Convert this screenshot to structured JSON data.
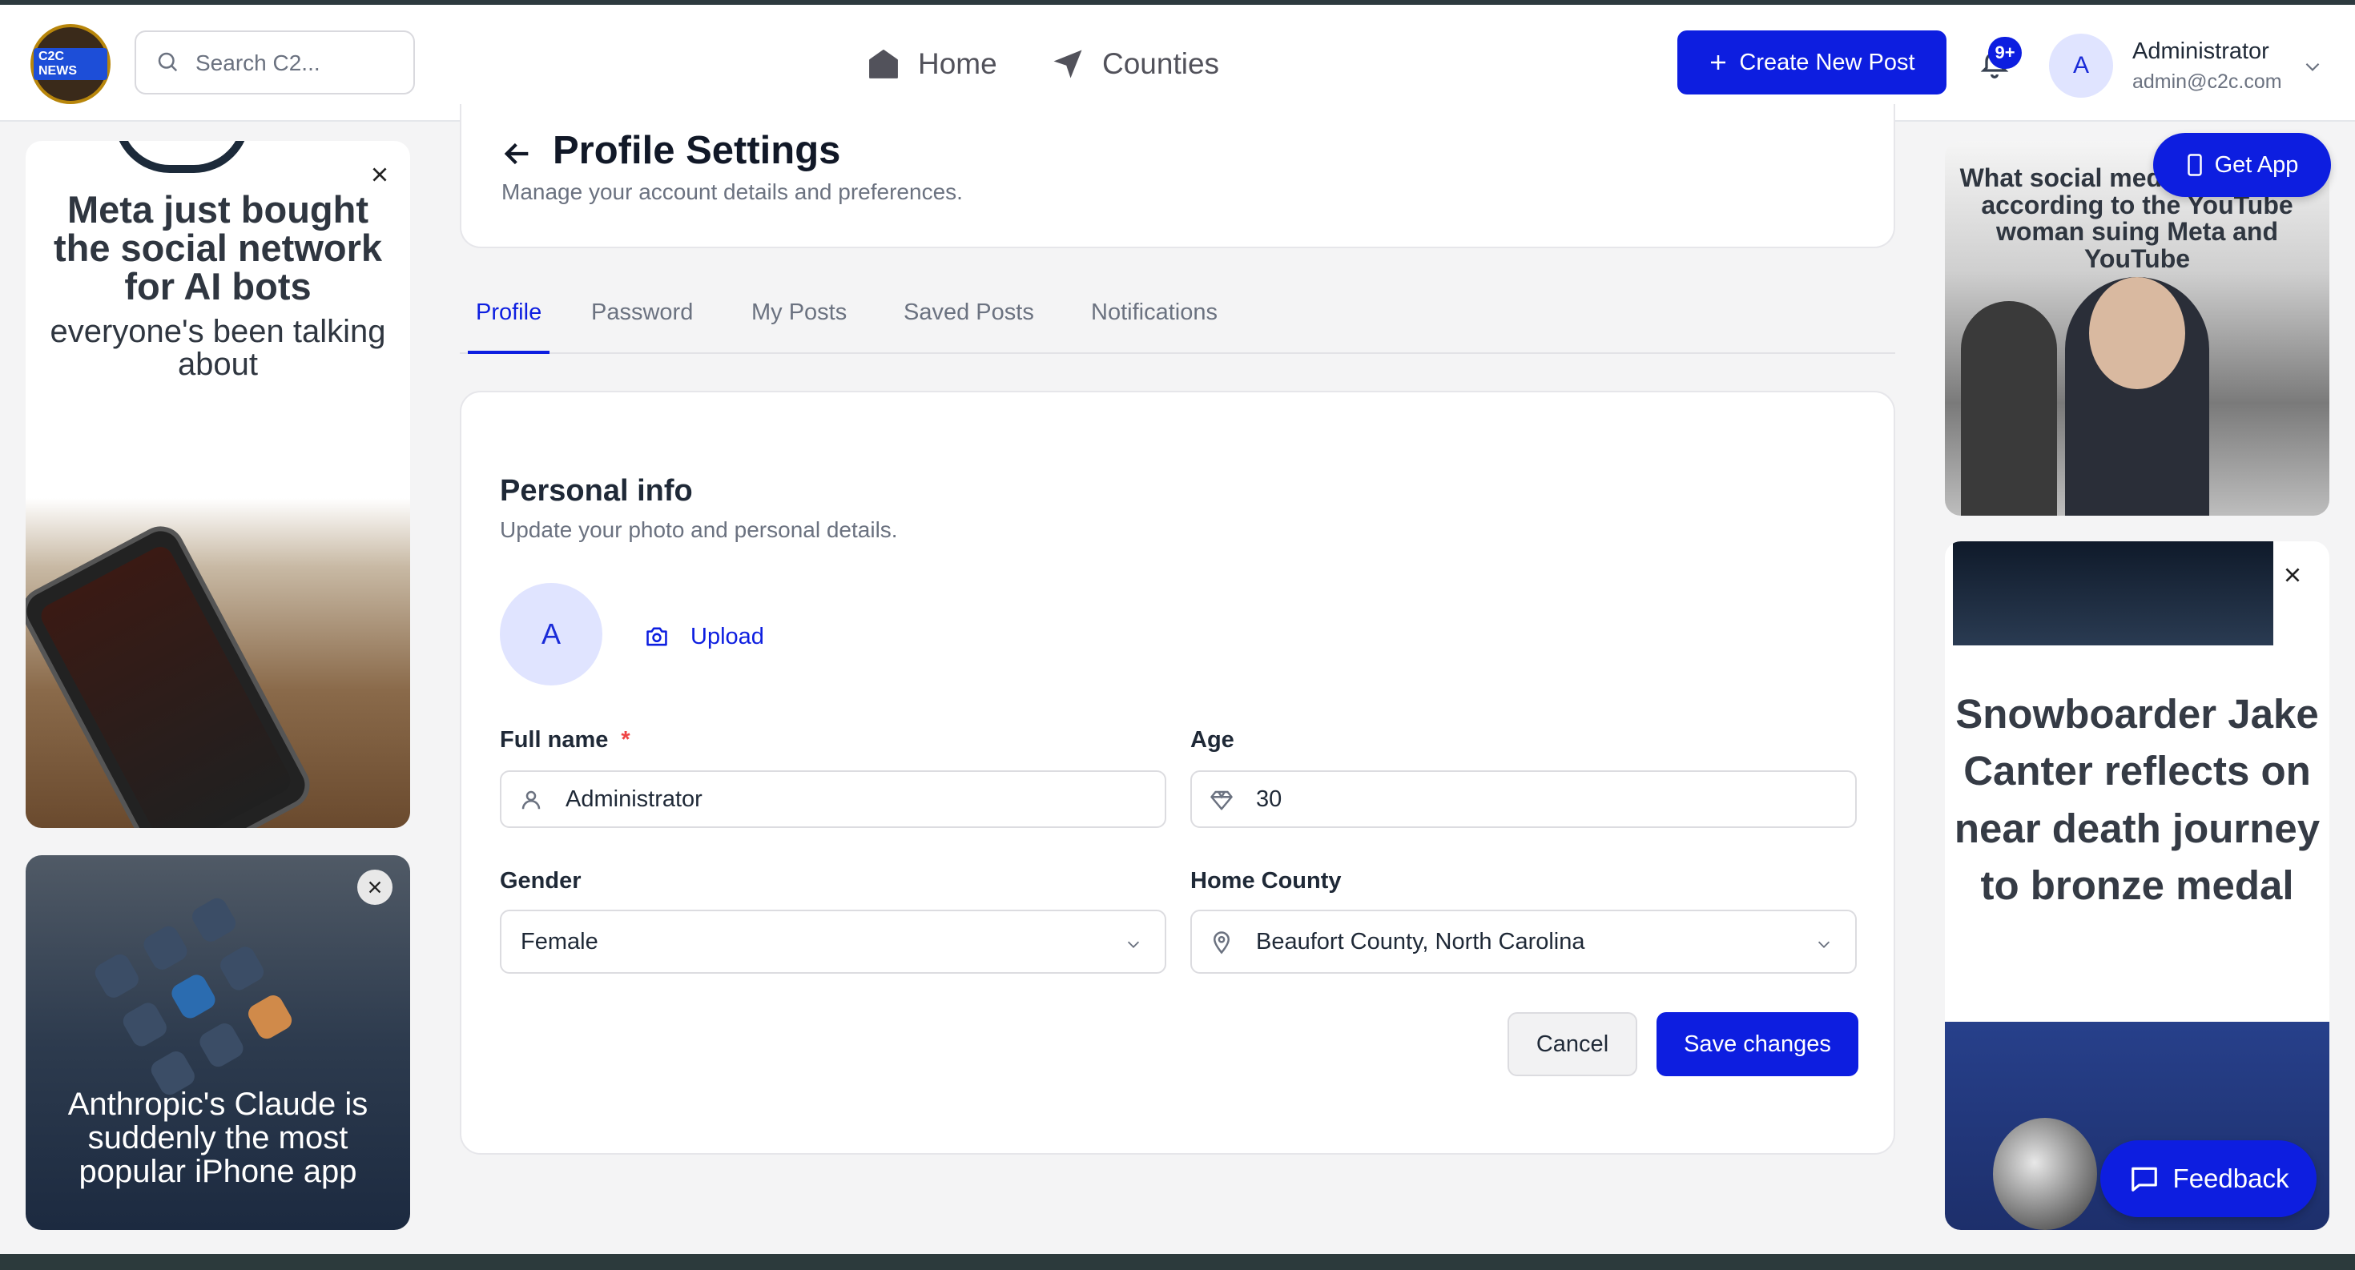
{
  "header": {
    "logo_text": "C2C NEWS",
    "search_placeholder": "Search C2...",
    "nav": [
      {
        "label": "Home",
        "icon": "home-icon"
      },
      {
        "label": "Counties",
        "icon": "navigation-arrow-icon"
      }
    ],
    "create_post_label": "Create New Post",
    "notification_badge": "9+",
    "avatar_initial": "A",
    "user_name": "Administrator",
    "user_email": "admin@c2c.com"
  },
  "floating": {
    "get_app_label": "Get App",
    "feedback_label": "Feedback"
  },
  "ads": {
    "left_top": {
      "headline": "Meta just bought the social network for AI bots",
      "sub": "everyone's been talking about"
    },
    "left_bottom": {
      "headline": "Anthropic's Claude is suddenly the most popular iPhone app"
    },
    "right_top": {
      "headline": "What social media looks like, according to the YouTube woman suing Meta and YouTube"
    },
    "right_bottom": {
      "headline": "Snowboarder Jake Canter reflects on near death journey to bronze medal"
    }
  },
  "page": {
    "title": "Profile Settings",
    "subtitle": "Manage your account details and preferences."
  },
  "tabs": [
    {
      "label": "Profile",
      "active": true
    },
    {
      "label": "Password",
      "active": false
    },
    {
      "label": "My Posts",
      "active": false
    },
    {
      "label": "Saved Posts",
      "active": false
    },
    {
      "label": "Notifications",
      "active": false
    }
  ],
  "form": {
    "section_title": "Personal info",
    "section_subtitle": "Update your photo and personal details.",
    "avatar_initial": "A",
    "upload_label": "Upload",
    "full_name_label": "Full name",
    "required_mark": "*",
    "full_name_value": "Administrator",
    "age_label": "Age",
    "age_value": "30",
    "gender_label": "Gender",
    "gender_value": "Female",
    "county_label": "Home County",
    "county_value": "Beaufort County, North Carolina",
    "cancel_label": "Cancel",
    "save_label": "Save changes"
  },
  "colors": {
    "primary": "#0d1ee0",
    "avatar_bg": "#e0e4ff",
    "required": "#ef4444"
  }
}
